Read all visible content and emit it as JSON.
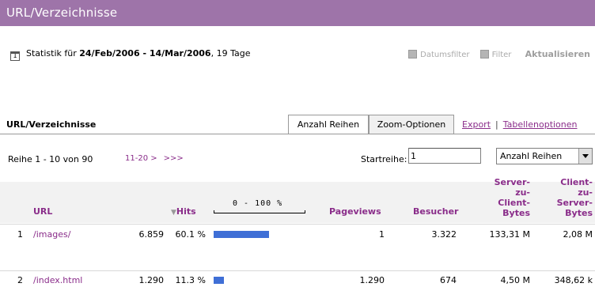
{
  "header": {
    "title": "URL/Verzeichnisse"
  },
  "stats": {
    "calendar_glyph": "1",
    "prefix": "Statistik für ",
    "range": "24/Feb/2006 - 14/Mar/2006",
    "suffix": ", 19 Tage"
  },
  "filters": {
    "datumsfilter": "Datumsfilter",
    "filter": "Filter",
    "aktualisieren": "Aktualisieren"
  },
  "section": {
    "title": "URL/Verzeichnisse",
    "tabs": [
      "Anzahl Reihen",
      "Zoom-Optionen"
    ],
    "links": {
      "export": "Export",
      "separator": "|",
      "tabellenoptionen": "Tabellenoptionen"
    }
  },
  "pagination": {
    "row_info": "Reihe 1 - 10 von 90",
    "next": "11-20 >",
    "last": ">>>",
    "start_label": "Startreihe:",
    "start_value": "1",
    "select_value": "Anzahl Reihen"
  },
  "table": {
    "headers": {
      "url": "URL",
      "hits": "Hits",
      "sort_glyph": "▼",
      "scale": "0 - 100 %",
      "pageviews": "Pageviews",
      "besucher": "Besucher",
      "server_client": [
        "Server-",
        "zu-",
        "Client-",
        "Bytes"
      ],
      "client_server": [
        "Client-",
        "zu-",
        "Server-",
        "Bytes"
      ]
    },
    "rows": [
      {
        "rank": "1",
        "url": "/images/",
        "hits": "6.859",
        "percent": "60.1 %",
        "bar_pct": 60.1,
        "pageviews": "1",
        "besucher": "3.322",
        "sc_bytes": "133,31 M",
        "cs_bytes": "2,08 M"
      },
      {
        "rank": "2",
        "url": "/index.html",
        "hits": "1.290",
        "percent": "11.3 %",
        "bar_pct": 11.3,
        "pageviews": "1.290",
        "besucher": "674",
        "sc_bytes": "4,50 M",
        "cs_bytes": "348,62 k"
      }
    ]
  },
  "colors": {
    "title_bar": "#9e74a9",
    "link": "#8a2d8a",
    "bar": "#3f6fd6"
  }
}
